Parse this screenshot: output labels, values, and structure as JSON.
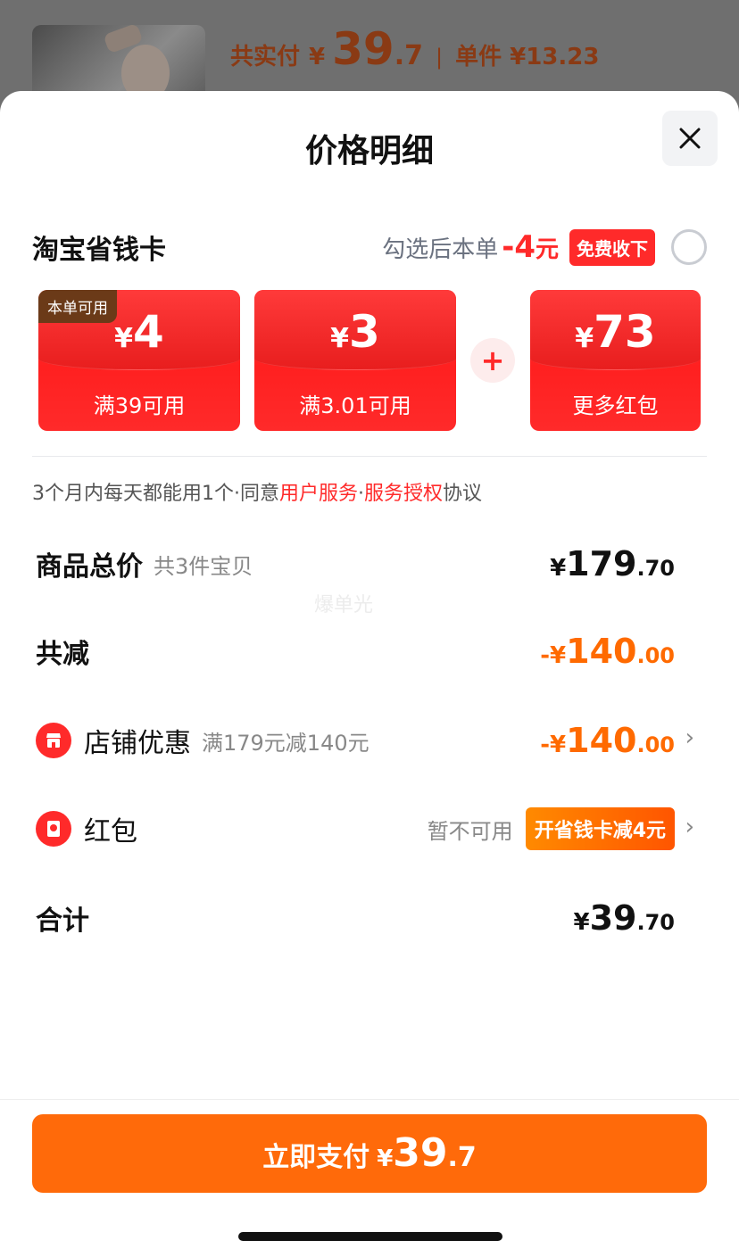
{
  "background": {
    "paid_label": "共实付",
    "paid_yen": "¥",
    "paid_int": "39",
    "paid_dec": ".7",
    "separator": "|",
    "unit_label": "单件 ¥13.23"
  },
  "sheet": {
    "title": "价格明细"
  },
  "savings_card": {
    "title": "淘宝省钱卡",
    "hint": "勾选后本单",
    "save_amount": "-4",
    "save_unit": "元",
    "free_badge": "免费收下",
    "coupons": [
      {
        "tag": "本单可用",
        "yen": "¥",
        "amount": "4",
        "condition": "满39可用"
      },
      {
        "tag": "",
        "yen": "¥",
        "amount": "3",
        "condition": "满3.01可用"
      },
      {
        "tag": "",
        "yen": "¥",
        "amount": "73",
        "condition": "更多红包"
      }
    ],
    "plus": "+"
  },
  "agreement": {
    "prefix": "3个月内每天都能用1个·同意",
    "link1": "用户服务",
    "dot": "·",
    "link2": "服务授权",
    "suffix": "协议"
  },
  "watermark": "爆单光",
  "rows": {
    "total": {
      "label": "商品总价",
      "sub": "共3件宝贝",
      "yen": "¥",
      "int": "179",
      "dec": ".70"
    },
    "reduce": {
      "label": "共减",
      "prefix": "-¥",
      "int": "140",
      "dec": ".00"
    },
    "shop": {
      "label": "店铺优惠",
      "sub": "满179元减140元",
      "prefix": "-¥",
      "int": "140",
      "dec": ".00",
      "chevron": "›"
    },
    "redpack": {
      "label": "红包",
      "na": "暂不可用",
      "badge": "开省钱卡减4元",
      "chevron": "›"
    },
    "sum": {
      "label": "合计",
      "yen": "¥",
      "int": "39",
      "dec": ".70"
    }
  },
  "pay_button": {
    "label": "立即支付",
    "yen": "¥",
    "int": "39",
    "dec": ".7"
  },
  "colors": {
    "accent_red": "#ff2a2a",
    "accent_orange": "#ff6a0a",
    "tag_brown": "#6b3a18"
  }
}
